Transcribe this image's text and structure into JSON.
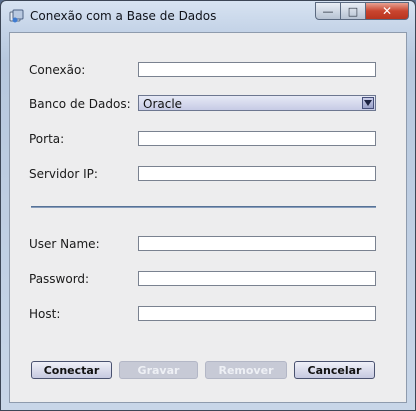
{
  "window": {
    "title": "Conexão com a Base de Dados",
    "controls": {
      "minimize": "—",
      "maximize": "□",
      "close": "✕"
    }
  },
  "form": {
    "connection_label": "Conexão:",
    "connection_value": "",
    "database_label": "Banco de Dados:",
    "database_selected": "Oracle",
    "port_label": "Porta:",
    "port_value": "",
    "server_ip_label": "Servidor IP:",
    "server_ip_value": "",
    "username_label": "User Name:",
    "username_value": "",
    "password_label": "Password:",
    "password_value": "",
    "host_label": "Host:",
    "host_value": ""
  },
  "buttons": {
    "connect": "Conectar",
    "save": "Gravar",
    "remove": "Remover",
    "cancel": "Cancelar"
  },
  "colors": {
    "accent": "#3e5d85",
    "disabled_button": "#c7cad6",
    "close_button": "#c9452f"
  }
}
